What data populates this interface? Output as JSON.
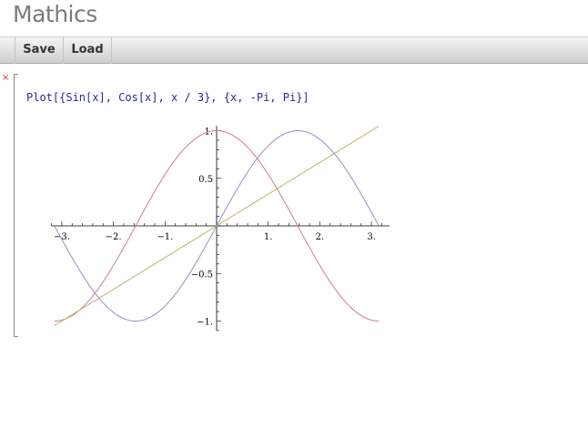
{
  "app": {
    "title": "Mathics"
  },
  "toolbar": {
    "save_label": "Save",
    "load_label": "Load"
  },
  "cell": {
    "close_icon": "×",
    "input": "Plot[{Sin[x], Cos[x], x / 3}, {x, -Pi, Pi}]"
  },
  "chart_data": {
    "type": "line",
    "title": "",
    "xlabel": "",
    "ylabel": "",
    "xlim": [
      -3.2,
      3.35
    ],
    "ylim": [
      -1.1,
      1.05
    ],
    "x_ticks": [
      {
        "value": -3,
        "label": "−3."
      },
      {
        "value": -2,
        "label": "−2."
      },
      {
        "value": -1,
        "label": "−1."
      },
      {
        "value": 1,
        "label": "1."
      },
      {
        "value": 2,
        "label": "2."
      },
      {
        "value": 3,
        "label": "3."
      }
    ],
    "y_ticks": [
      {
        "value": -1,
        "label": "−1."
      },
      {
        "value": -0.5,
        "label": "−0.5"
      },
      {
        "value": 0.5,
        "label": "0.5"
      },
      {
        "value": 1,
        "label": "1."
      }
    ],
    "x_range": [
      -3.14159,
      3.14159
    ],
    "series": [
      {
        "function": "sin",
        "color": "#9a8cc8"
      },
      {
        "function": "cos",
        "color": "#c97ba0"
      },
      {
        "function": "x/3",
        "color": "#bdb46c"
      }
    ]
  }
}
